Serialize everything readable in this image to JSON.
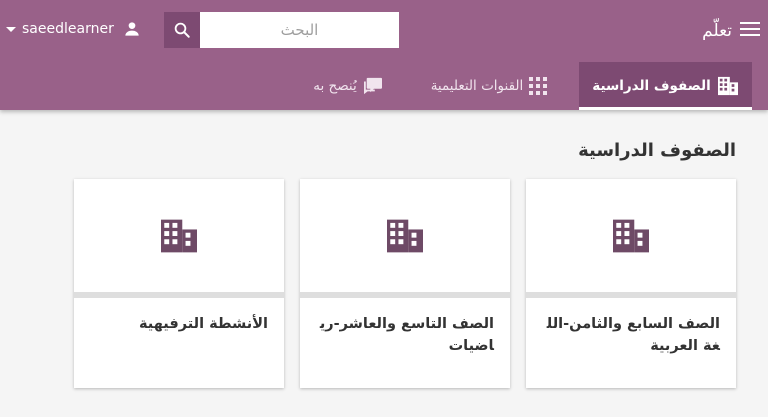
{
  "header": {
    "app_title": "تعلّم",
    "menu_icon": "menu-icon",
    "search": {
      "placeholder": "البحث",
      "value": "",
      "button_icon": "search-icon"
    },
    "user": {
      "username": "saeedlearner",
      "icon": "person-icon"
    }
  },
  "tabs": [
    {
      "label": "الصفوف الدراسية",
      "icon": "building-icon",
      "active": true
    },
    {
      "label": "القنوات التعليمية",
      "icon": "grid-icon",
      "active": false
    },
    {
      "label": "يُنصح به",
      "icon": "chat-icon",
      "active": false
    }
  ],
  "main": {
    "section_title": "الصفوف الدراسية",
    "classrooms": [
      {
        "title": "الصف السابع والثامن-اللغة العربية",
        "icon": "building-icon"
      },
      {
        "title": "الصف التاسع والعاشر-رياضيات",
        "icon": "building-icon"
      },
      {
        "title": "الأنشطة الترفيهية",
        "icon": "building-icon"
      }
    ]
  },
  "colors": {
    "appbar": "#996189",
    "active_tab": "#7d4a72",
    "icon": "#6e4a66"
  }
}
